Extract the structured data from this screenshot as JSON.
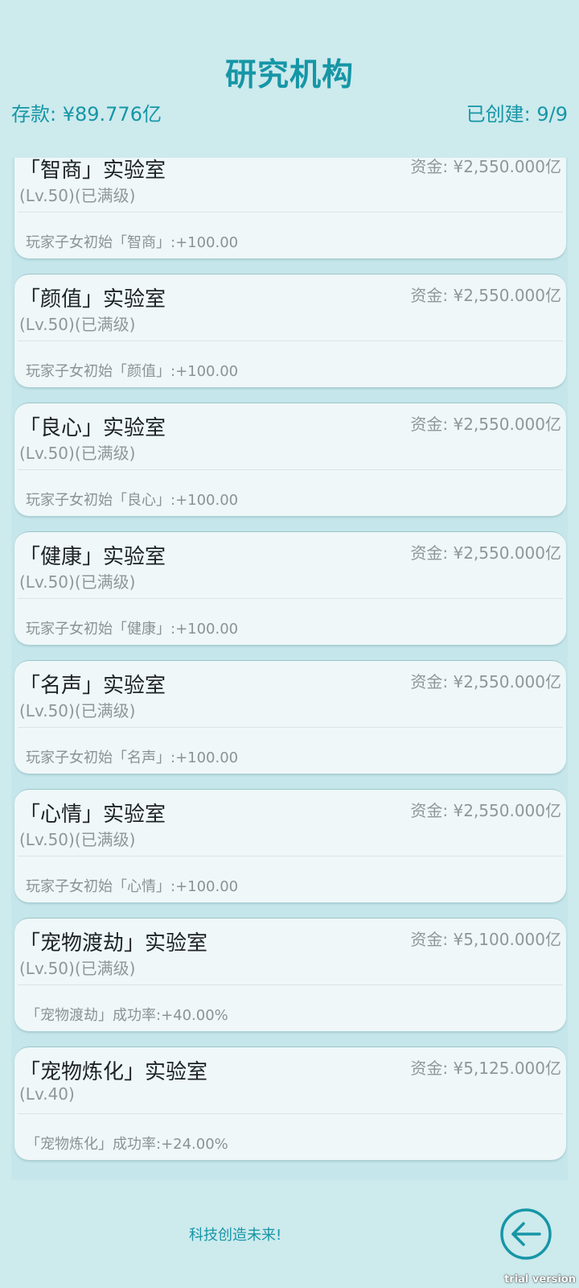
{
  "header": {
    "title": "研究机构",
    "savings": "存款: ¥89.776亿",
    "created": "已创建: 9/9"
  },
  "labs": [
    {
      "name": "「智商」实验室",
      "fund": "资金: ¥2,550.000亿",
      "level": "(Lv.50)(已满级)",
      "effect": "玩家子女初始「智商」:+100.00"
    },
    {
      "name": "「颜值」实验室",
      "fund": "资金: ¥2,550.000亿",
      "level": "(Lv.50)(已满级)",
      "effect": "玩家子女初始「颜值」:+100.00"
    },
    {
      "name": "「良心」实验室",
      "fund": "资金: ¥2,550.000亿",
      "level": "(Lv.50)(已满级)",
      "effect": "玩家子女初始「良心」:+100.00"
    },
    {
      "name": "「健康」实验室",
      "fund": "资金: ¥2,550.000亿",
      "level": "(Lv.50)(已满级)",
      "effect": "玩家子女初始「健康」:+100.00"
    },
    {
      "name": "「名声」实验室",
      "fund": "资金: ¥2,550.000亿",
      "level": "(Lv.50)(已满级)",
      "effect": "玩家子女初始「名声」:+100.00"
    },
    {
      "name": "「心情」实验室",
      "fund": "资金: ¥2,550.000亿",
      "level": "(Lv.50)(已满级)",
      "effect": "玩家子女初始「心情」:+100.00"
    },
    {
      "name": "「宠物渡劫」实验室",
      "fund": "资金: ¥5,100.000亿",
      "level": "(Lv.50)(已满级)",
      "effect": "「宠物渡劫」成功率:+40.00%"
    },
    {
      "name": "「宠物炼化」实验室",
      "fund": "资金: ¥5,125.000亿",
      "level": "(Lv.40)",
      "effect": "「宠物炼化」成功率:+24.00%"
    }
  ],
  "footer": {
    "slogan": "科技创造未来!",
    "back_icon": "arrow-left-circle-icon"
  },
  "watermark": "trial version"
}
